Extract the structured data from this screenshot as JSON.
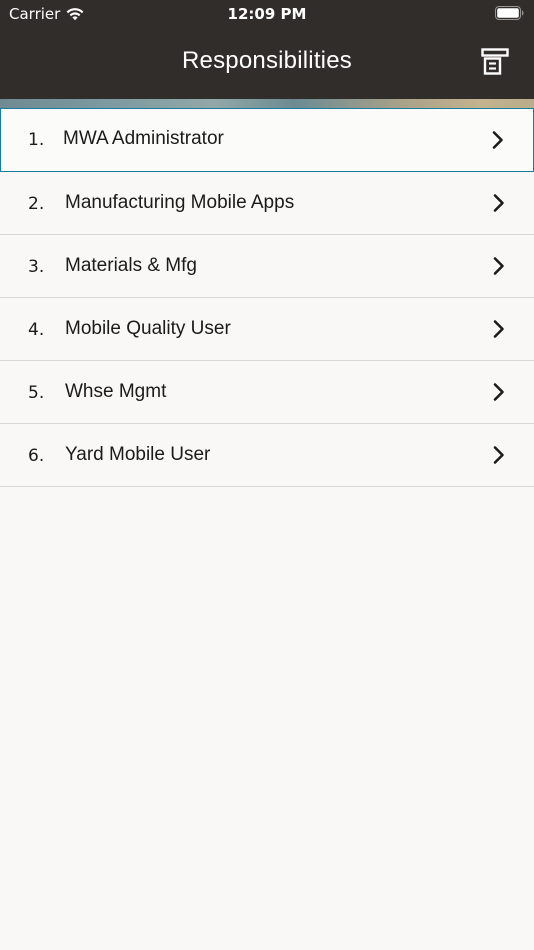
{
  "status_bar": {
    "carrier": "Carrier",
    "time": "12:09 PM",
    "icons": [
      "wifi-icon",
      "battery-icon"
    ]
  },
  "nav": {
    "title": "Responsibilities",
    "action_icon": "archive-icon"
  },
  "colors": {
    "header_bg": "#312d2a",
    "page_bg": "#f9f8f6",
    "selected_border": "#1a7c9a",
    "divider": "#d9d7d3"
  },
  "responsibilities": [
    {
      "num": "1.",
      "label": "MWA Administrator",
      "selected": true
    },
    {
      "num": "2.",
      "label": "Manufacturing Mobile Apps",
      "selected": false
    },
    {
      "num": "3.",
      "label": "Materials & Mfg",
      "selected": false
    },
    {
      "num": "4.",
      "label": "Mobile Quality User",
      "selected": false
    },
    {
      "num": "5.",
      "label": "Whse Mgmt",
      "selected": false
    },
    {
      "num": "6.",
      "label": "Yard Mobile User",
      "selected": false
    }
  ]
}
